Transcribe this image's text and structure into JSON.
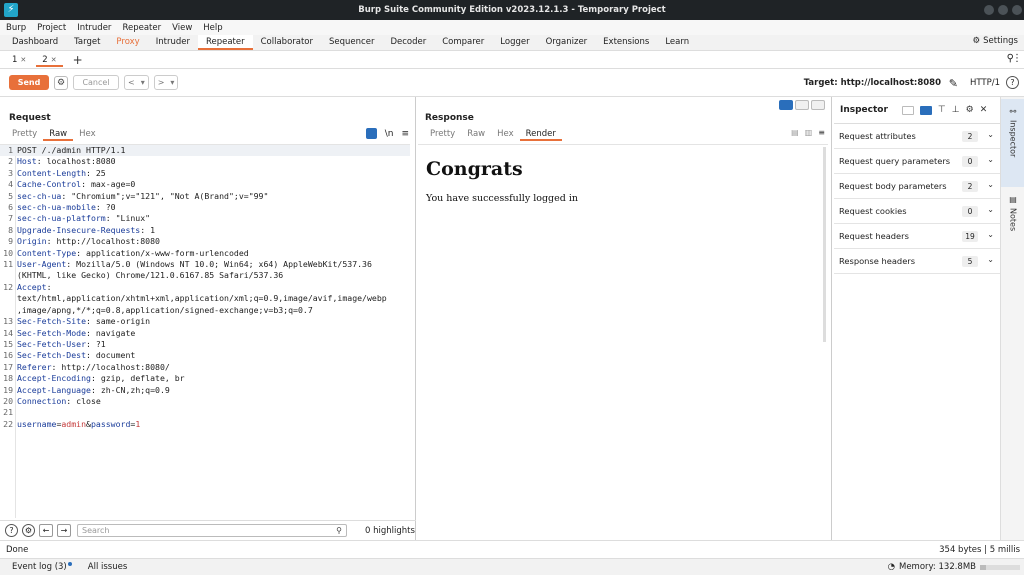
{
  "window": {
    "title": "Burp Suite Community Edition v2023.12.1.3 - Temporary Project"
  },
  "menu": [
    "Burp",
    "Project",
    "Intruder",
    "Repeater",
    "View",
    "Help"
  ],
  "main_tabs": [
    "Dashboard",
    "Target",
    "Proxy",
    "Intruder",
    "Repeater",
    "Collaborator",
    "Sequencer",
    "Decoder",
    "Comparer",
    "Logger",
    "Organizer",
    "Extensions",
    "Learn"
  ],
  "active_main_tab": "Repeater",
  "settings_label": "Settings",
  "repeater_tabs": [
    "1",
    "2"
  ],
  "toolbar": {
    "send": "Send",
    "cancel": "Cancel",
    "target": "Target: http://localhost:8080",
    "http_version": "HTTP/1"
  },
  "request": {
    "title": "Request",
    "view_tabs": [
      "Pretty",
      "Raw",
      "Hex"
    ],
    "active_view": "Raw",
    "newline_toggle": "\\n",
    "lines": [
      {
        "n": "1",
        "name": "",
        "value": "POST /./admin HTTP/1.1"
      },
      {
        "n": "2",
        "name": "Host",
        "value": "localhost:8080"
      },
      {
        "n": "3",
        "name": "Content-Length",
        "value": "25"
      },
      {
        "n": "4",
        "name": "Cache-Control",
        "value": "max-age=0"
      },
      {
        "n": "5",
        "name": "sec-ch-ua",
        "value": "\"Chromium\";v=\"121\", \"Not A(Brand\";v=\"99\""
      },
      {
        "n": "6",
        "name": "sec-ch-ua-mobile",
        "value": "?0"
      },
      {
        "n": "7",
        "name": "sec-ch-ua-platform",
        "value": "\"Linux\""
      },
      {
        "n": "8",
        "name": "Upgrade-Insecure-Requests",
        "value": "1"
      },
      {
        "n": "9",
        "name": "Origin",
        "value": "http://localhost:8080"
      },
      {
        "n": "10",
        "name": "Content-Type",
        "value": "application/x-www-form-urlencoded"
      },
      {
        "n": "11",
        "name": "User-Agent",
        "value": "Mozilla/5.0 (Windows NT 10.0; Win64; x64) AppleWebKit/537.36"
      },
      {
        "n": "",
        "name": "",
        "value": "(KHTML, like Gecko) Chrome/121.0.6167.85 Safari/537.36"
      },
      {
        "n": "12",
        "name": "Accept",
        "value": ""
      },
      {
        "n": "",
        "name": "",
        "value": "text/html,application/xhtml+xml,application/xml;q=0.9,image/avif,image/webp"
      },
      {
        "n": "",
        "name": "",
        "value": ",image/apng,*/*;q=0.8,application/signed-exchange;v=b3;q=0.7"
      },
      {
        "n": "13",
        "name": "Sec-Fetch-Site",
        "value": "same-origin"
      },
      {
        "n": "14",
        "name": "Sec-Fetch-Mode",
        "value": "navigate"
      },
      {
        "n": "15",
        "name": "Sec-Fetch-User",
        "value": "?1"
      },
      {
        "n": "16",
        "name": "Sec-Fetch-Dest",
        "value": "document"
      },
      {
        "n": "17",
        "name": "Referer",
        "value": "http://localhost:8080/"
      },
      {
        "n": "18",
        "name": "Accept-Encoding",
        "value": "gzip, deflate, br"
      },
      {
        "n": "19",
        "name": "Accept-Language",
        "value": "zh-CN,zh;q=0.9"
      },
      {
        "n": "20",
        "name": "Connection",
        "value": "close"
      },
      {
        "n": "21",
        "name": "",
        "value": ""
      }
    ],
    "body_line": {
      "n": "22",
      "p1": "username",
      "v1": "admin",
      "p2": "password",
      "v2": "1"
    },
    "search_placeholder": "Search",
    "highlights": "0 highlights"
  },
  "response": {
    "title": "Response",
    "view_tabs": [
      "Pretty",
      "Raw",
      "Hex",
      "Render"
    ],
    "active_view": "Render",
    "heading": "Congrats",
    "message": "You have successfully logged in"
  },
  "inspector": {
    "title": "Inspector",
    "rows": [
      {
        "label": "Request attributes",
        "count": "2"
      },
      {
        "label": "Request query parameters",
        "count": "0"
      },
      {
        "label": "Request body parameters",
        "count": "2"
      },
      {
        "label": "Request cookies",
        "count": "0"
      },
      {
        "label": "Request headers",
        "count": "19"
      },
      {
        "label": "Response headers",
        "count": "5"
      }
    ]
  },
  "side_rail": [
    "Inspector",
    "Notes"
  ],
  "status": {
    "left": "Done",
    "right": "354 bytes | 5 millis"
  },
  "bottom": {
    "event_log": "Event log (3)",
    "all_issues": "All issues",
    "memory": "Memory: 132.8MB",
    "memory_fraction": 0.15
  },
  "colors": {
    "accent": "#e8703a",
    "blue": "#2a6ebb"
  }
}
